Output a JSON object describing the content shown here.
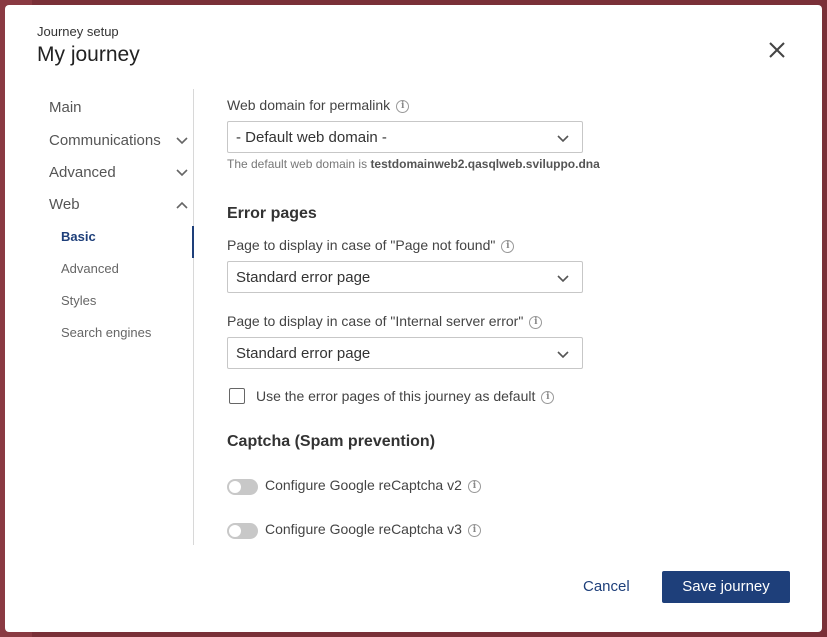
{
  "header": {
    "kicker": "Journey setup",
    "title": "My journey"
  },
  "sidebar": {
    "items": [
      {
        "label": "Main"
      },
      {
        "label": "Communications"
      },
      {
        "label": "Advanced"
      },
      {
        "label": "Web"
      }
    ],
    "web_subitems": [
      {
        "label": "Basic",
        "active": true
      },
      {
        "label": "Advanced"
      },
      {
        "label": "Styles"
      },
      {
        "label": "Search engines"
      }
    ]
  },
  "content": {
    "permalink": {
      "label": "Web domain for permalink",
      "selected": "- Default web domain -",
      "hint_prefix": "The default web domain is",
      "hint_domain": "testdomainweb2.qasqlweb.sviluppo.dna"
    },
    "error_pages": {
      "heading": "Error pages",
      "not_found_label": "Page to display in case of \"Page not found\"",
      "not_found_selected": "Standard error page",
      "server_error_label": "Page to display in case of \"Internal server error\"",
      "server_error_selected": "Standard error page",
      "default_checkbox_label": "Use the error pages of this journey as default",
      "default_checked": false
    },
    "captcha": {
      "heading": "Captcha (Spam prevention)",
      "v2_label": "Configure Google reCaptcha v2",
      "v2_on": false,
      "v3_label": "Configure Google reCaptcha v3",
      "v3_on": false
    }
  },
  "footer": {
    "cancel_label": "Cancel",
    "save_label": "Save journey"
  },
  "colors": {
    "accent": "#1e3f7a",
    "backdrop": "#7a3038"
  }
}
